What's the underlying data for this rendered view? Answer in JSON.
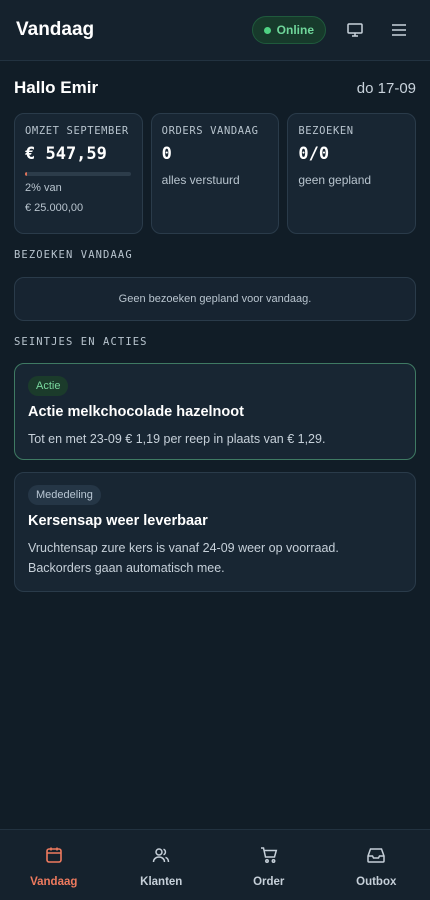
{
  "header": {
    "title": "Vandaag",
    "status": "Online",
    "icons": [
      "monitor-icon",
      "menu-icon"
    ]
  },
  "greeting": {
    "text": "Hallo Emir",
    "date": "do 17-09"
  },
  "stats": [
    {
      "label": "OMZET SEPTEMBER",
      "value": "€ 547,59",
      "progress_percent": 2,
      "progress_text": "2% van",
      "target": "€ 25.000,00"
    },
    {
      "label": "ORDERS VANDAAG",
      "value": "0",
      "sub": "alles verstuurd"
    },
    {
      "label": "BEZOEKEN",
      "value": "0/0",
      "sub": "geen gepland"
    }
  ],
  "visits": {
    "section_label": "BEZOEKEN VANDAAG",
    "empty_text": "Geen bezoeken gepland voor vandaag."
  },
  "notices": {
    "section_label": "SEINTJES EN ACTIES",
    "items": [
      {
        "tag": "Actie",
        "title": "Actie melkchocolade hazelnoot",
        "body": "Tot en met 23-09 € 1,19 per reep in plaats van € 1,29."
      },
      {
        "tag": "Mededeling",
        "title": "Kersensap weer leverbaar",
        "body": "Vruchtensap zure kers is vanaf 24-09 weer op voorraad. Backorders gaan automatisch mee."
      }
    ]
  },
  "nav": {
    "items": [
      {
        "label": "Vandaag",
        "icon": "calendar-icon",
        "active": true
      },
      {
        "label": "Klanten",
        "icon": "users-icon",
        "active": false
      },
      {
        "label": "Order",
        "icon": "cart-icon",
        "active": false
      },
      {
        "label": "Outbox",
        "icon": "inbox-icon",
        "active": false
      }
    ]
  },
  "colors": {
    "accent": "#ee7a5e",
    "online": "#4fd283",
    "background": "#111d27"
  }
}
